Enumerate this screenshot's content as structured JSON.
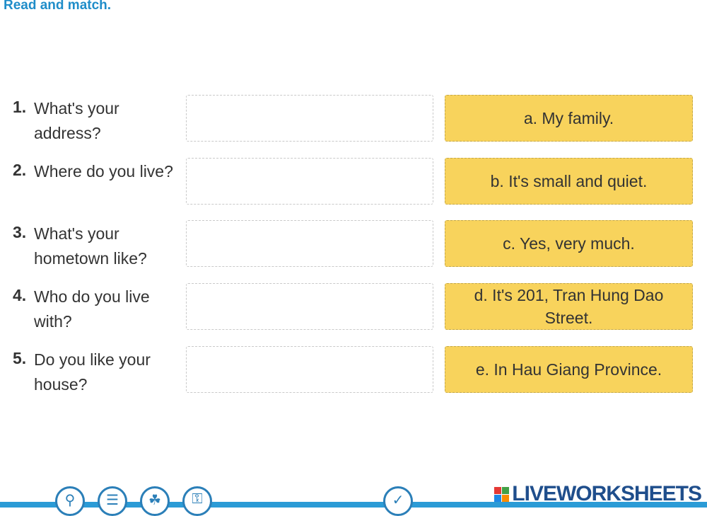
{
  "instruction": "Read and match.",
  "questions": [
    {
      "number": "1.",
      "text": "What's your address?"
    },
    {
      "number": "2.",
      "text": "Where do you live?"
    },
    {
      "number": "3.",
      "text": "What's your hometown like?"
    },
    {
      "number": "4.",
      "text": "Who do you live with?"
    },
    {
      "number": "5.",
      "text": "Do you like your house?"
    }
  ],
  "answers": [
    "a. My family.",
    "b. It's small and quiet.",
    "c. Yes, very much.",
    "d. It's 201, Tran Hung Dao Street.",
    "e. In Hau Giang Province."
  ],
  "toolbar": {
    "zoom_icon": "magnifier-icon",
    "list_icon": "list-icon",
    "audio_icon": "octopus-icon",
    "key_icon": "key-icon",
    "check_icon": "checkmark-icon"
  },
  "logo": {
    "text": "LIVEWORKSHEETS",
    "colors": [
      "#e53935",
      "#43a047",
      "#1e88e5",
      "#fb8c00"
    ]
  }
}
